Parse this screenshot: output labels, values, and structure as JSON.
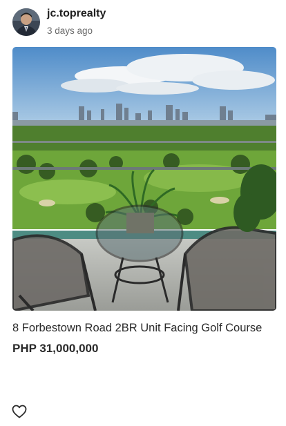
{
  "post": {
    "username": "jc.toprealty",
    "timestamp": "3 days ago",
    "avatar_icon": "profile-photo",
    "image_alt": "balcony-view-photo",
    "listing_title": "8 Forbestown Road 2BR Unit Facing Golf Course",
    "price": "PHP 31,000,000",
    "like_icon": "heart-outline-icon"
  },
  "colors": {
    "text": "#2a2a2a",
    "muted": "#6b6b6b",
    "sky": "#5b93c8",
    "grass": "#6ea63a"
  }
}
